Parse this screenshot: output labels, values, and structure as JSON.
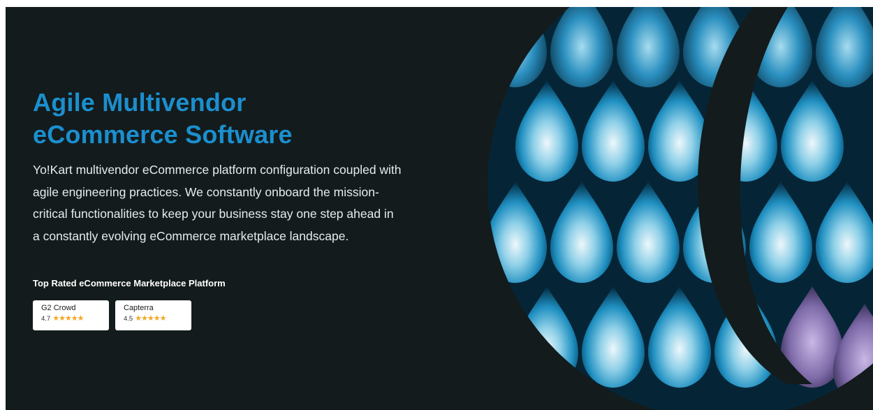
{
  "hero": {
    "headline_line1": "Agile Multivendor",
    "headline_line2": "eCommerce Software",
    "description": "Yo!Kart multivendor eCommerce platform configuration coupled with agile engineering practices. We constantly onboard the mission-critical functionalities to keep your business stay one step ahead in a constantly evolving eCommerce marketplace landscape.",
    "rated_label": "Top Rated eCommerce Marketplace Platform",
    "badges": [
      {
        "name": "G2 Crowd",
        "score": "4.7",
        "stars": "★★★★★"
      },
      {
        "name": "Capterra",
        "score": "4.5",
        "stars": "★★★★★"
      }
    ]
  },
  "colors": {
    "background": "#131b1c",
    "headline": "#1b8fcf",
    "star": "#f5a623",
    "text": "#e6ecee"
  }
}
